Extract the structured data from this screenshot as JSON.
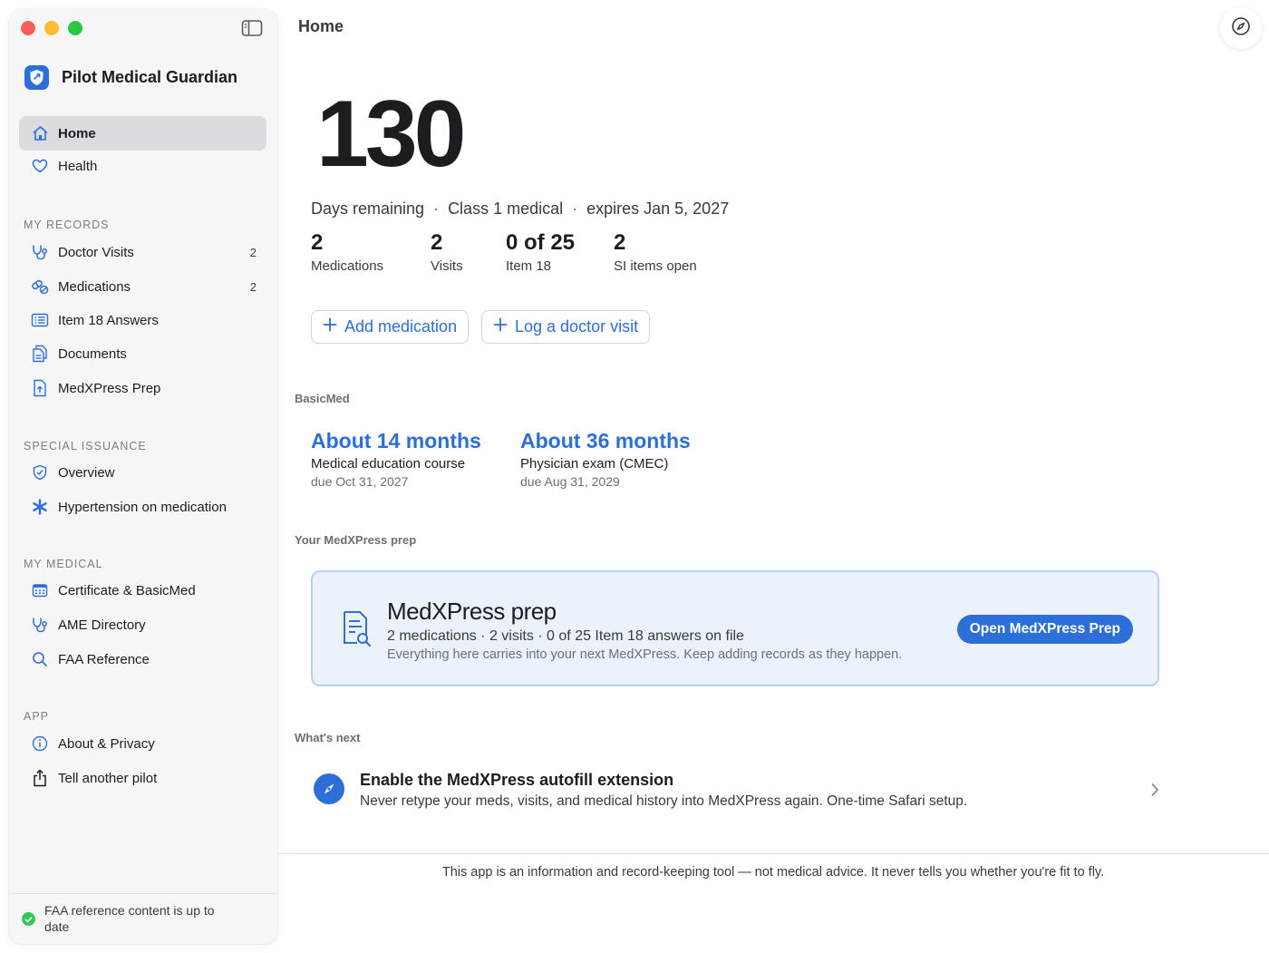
{
  "app": {
    "title": "Pilot Medical Guardian"
  },
  "sidebar": {
    "primary": [
      {
        "label": "Home",
        "icon": "house-icon",
        "active": true
      },
      {
        "label": "Health",
        "icon": "heart-icon"
      }
    ],
    "sections": [
      {
        "label": "MY RECORDS",
        "items": [
          {
            "label": "Doctor Visits",
            "icon": "stethoscope-icon",
            "badge": "2"
          },
          {
            "label": "Medications",
            "icon": "pills-icon",
            "badge": "2"
          },
          {
            "label": "Item 18 Answers",
            "icon": "list-icon"
          },
          {
            "label": "Documents",
            "icon": "documents-icon"
          },
          {
            "label": "MedXPress Prep",
            "icon": "document-upload-icon"
          }
        ]
      },
      {
        "label": "SPECIAL ISSUANCE",
        "items": [
          {
            "label": "Overview",
            "icon": "shield-check-icon"
          },
          {
            "label": "Hypertension on medication",
            "icon": "asterisk-icon"
          }
        ]
      },
      {
        "label": "MY MEDICAL",
        "items": [
          {
            "label": "Certificate & BasicMed",
            "icon": "calendar-icon"
          },
          {
            "label": "AME Directory",
            "icon": "stethoscope-icon"
          },
          {
            "label": "FAA Reference",
            "icon": "search-icon"
          }
        ]
      },
      {
        "label": "APP",
        "items": [
          {
            "label": "About & Privacy",
            "icon": "info-icon"
          },
          {
            "label": "Tell another pilot",
            "icon": "share-icon"
          }
        ]
      }
    ],
    "footer": {
      "text": "FAA reference content is up to date"
    }
  },
  "main": {
    "page_title": "Home",
    "days_remaining": "130",
    "summary": {
      "days_label": "Days remaining",
      "class": "Class 1 medical",
      "expires": "expires Jan 5, 2027",
      "separator": "·"
    },
    "stats": [
      {
        "value": "2",
        "label": "Medications"
      },
      {
        "value": "2",
        "label": "Visits"
      },
      {
        "value": "0 of 25",
        "label": "Item 18"
      },
      {
        "value": "2",
        "label": "SI items open"
      }
    ],
    "actions": {
      "add_medication": "Add medication",
      "log_visit": "Log a doctor visit"
    },
    "basicmed": {
      "label": "BasicMed",
      "items": [
        {
          "big": "About 14 months",
          "sub": "Medical education course",
          "due": "due Oct 31, 2027"
        },
        {
          "big": "About 36 months",
          "sub": "Physician exam (CMEC)",
          "due": "due Aug 31, 2029"
        }
      ]
    },
    "prep": {
      "label": "Your MedXPress prep",
      "title": "MedXPress prep",
      "line1": "2 medications · 2 visits · 0 of 25 Item 18 answers on file",
      "line2": "Everything here carries into your next MedXPress. Keep adding records as they happen.",
      "button": "Open MedXPress Prep"
    },
    "next": {
      "label": "What's next",
      "title": "Enable the MedXPress autofill extension",
      "desc": "Never retype your meds, visits, and medical history into MedXPress again. One-time Safari setup."
    },
    "disclaimer": "This app is an information and record-keeping tool — not medical advice. It never tells you whether you're fit to fly."
  },
  "colors": {
    "accent": "#2d6fd8",
    "sidebar_bg": "#f6f6f6",
    "card_bg": "#ebf2fc",
    "success": "#34c759"
  }
}
